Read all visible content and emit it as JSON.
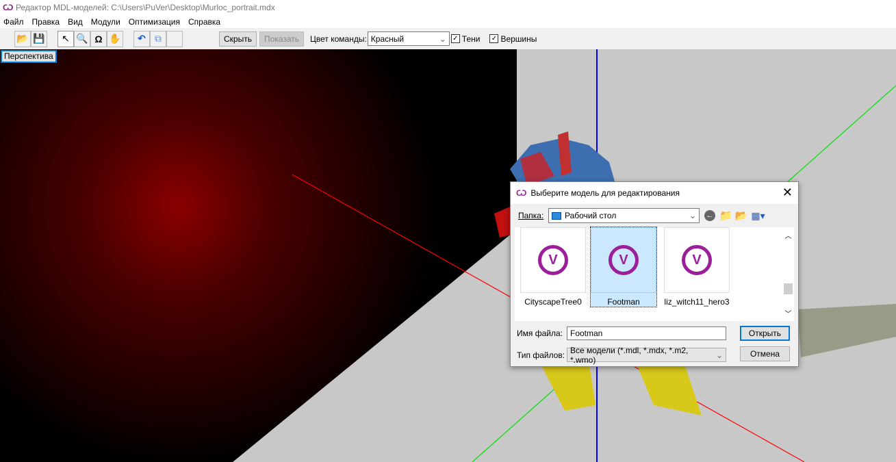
{
  "window": {
    "title": "Редактор MDL-моделей: C:\\Users\\PuVer\\Desktop\\Murloc_portrait.mdx"
  },
  "menu": [
    "Файл",
    "Правка",
    "Вид",
    "Модули",
    "Оптимизация",
    "Справка"
  ],
  "toolbar": {
    "hide_label": "Скрыть",
    "show_label": "Показать",
    "team_color_label": "Цвет команды:",
    "team_color_value": "Красный",
    "shadows_label": "Тени",
    "vertices_label": "Вершины"
  },
  "viewport": {
    "label": "Перспектива"
  },
  "dialog": {
    "title": "Выберите модель для редактирования",
    "folder_label": "Папка:",
    "folder_value": "Рабочий стол",
    "files": [
      {
        "name": "CityscapeTree0",
        "selected": false
      },
      {
        "name": "Footman",
        "selected": true
      },
      {
        "name": "liz_witch11_hero3",
        "selected": false
      }
    ],
    "filename_label": "Имя файла:",
    "filename_value": "Footman",
    "filetype_label": "Тип файлов:",
    "filetype_value": "Все модели (*.mdl, *.mdx, *.m2, *.wmo)",
    "open_label": "Открыть",
    "cancel_label": "Отмена"
  },
  "colors": {
    "accent": "#0078d7",
    "selection": "#cce8ff",
    "logo": "#9b1f9b"
  }
}
